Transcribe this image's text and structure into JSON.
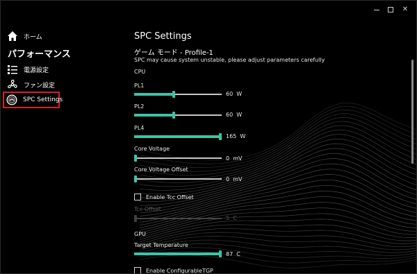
{
  "window": {
    "controls": {
      "minimize": "—",
      "maximize": "☐",
      "close": "✕"
    }
  },
  "sidebar": {
    "home_label": "ホーム",
    "section_title": "パフォーマンス",
    "items": [
      {
        "label": "電源設定",
        "icon": "list-icon"
      },
      {
        "label": "ファン設定",
        "icon": "fan-icon"
      },
      {
        "label": "SPC Settings",
        "icon": "gauge-icon",
        "selected": true
      }
    ]
  },
  "main": {
    "title": "SPC Settings",
    "profile": "ゲーム モード - Profile-1",
    "warning": "SPC may cause system unstable, please adjust parameters carefully",
    "cpu_label": "CPU",
    "gpu_label": "GPU",
    "params": {
      "pl1": {
        "label": "PL1",
        "value": "60",
        "unit": "W",
        "fraction": 0.45
      },
      "pl2": {
        "label": "PL2",
        "value": "60",
        "unit": "W",
        "fraction": 0.45
      },
      "pl4": {
        "label": "PL4",
        "value": "165",
        "unit": "W",
        "fraction": 1.0
      },
      "core_voltage": {
        "label": "Core Voltage",
        "value": "0",
        "unit": "mV",
        "fraction": 0.0
      },
      "core_voltage_offset": {
        "label": "Core Voltage Offset",
        "value": "0",
        "unit": "mV",
        "fraction": 0.0
      },
      "tcc_offset": {
        "label": "Tcc Offset",
        "value": "5",
        "unit": "C",
        "fraction": 0.0,
        "disabled": true
      },
      "target_temperature": {
        "label": "Target Temperature",
        "value": "87",
        "unit": "C",
        "fraction": 1.0
      }
    },
    "enable_tcc_offset": "Enable Tcc Offset",
    "enable_configurable_tgp": "Enable ConfigurableTGP"
  },
  "colors": {
    "accent": "#39c5a8",
    "highlight_border": "#d9202b",
    "background": "#000000"
  }
}
